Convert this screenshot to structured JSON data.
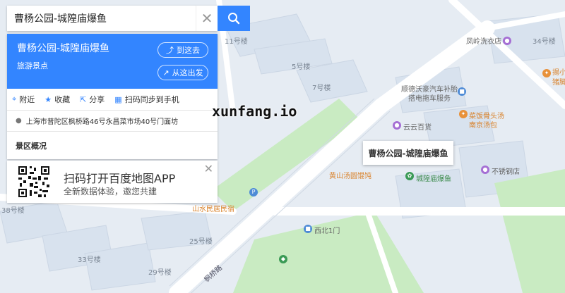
{
  "search": {
    "query": "曹杨公园-城隍庙爆鱼",
    "clear_icon": "close-icon",
    "search_icon": "search-icon"
  },
  "poi": {
    "name": "曹杨公园-城隍庙爆鱼",
    "category": "旅游景点",
    "go_here": "到这去",
    "from_here": "从这出发",
    "actions": [
      "附近",
      "收藏",
      "分享",
      "扫码同步到手机"
    ],
    "address": "上海市普陀区枫桥路46号永昌菜市场40号门面坊",
    "section": "景区概况"
  },
  "promo": {
    "title": "扫码打开百度地图APP",
    "subtitle": "全新数据体验，邀您共建"
  },
  "watermark": "xunfang.io",
  "map_labels": {
    "bld_11": "11号楼",
    "bld_5": "5号楼",
    "bld_7": "7号楼",
    "bld_34": "34号楼",
    "bld_38": "38号楼",
    "bld_25": "25号楼",
    "bld_33": "33号楼",
    "bld_29": "29号楼",
    "fengling": "凤岭洗衣店",
    "shunde": "顺德沃豪汽车补胎",
    "shunde2": "搭电拖车服务",
    "caifan": "菜饭骨头汤",
    "nanjing": "南京汤包",
    "yunyun": "云云百货",
    "huangshan": "黄山汤圆馄饨",
    "chenghuang": "城隍庙爆鱼",
    "buxiu": "不锈钢店",
    "shanshui": "山水民居民宿",
    "xibei": "西北1门",
    "callout": "曹杨公园-城隍庙爆鱼",
    "road": "枫桥路",
    "partial": "揚小",
    "partial2": "猪脚"
  },
  "colors": {
    "accent": "#3385ff",
    "map_bg": "#e6ecf3",
    "road": "#ffffff",
    "green": "#c9ebc2"
  }
}
